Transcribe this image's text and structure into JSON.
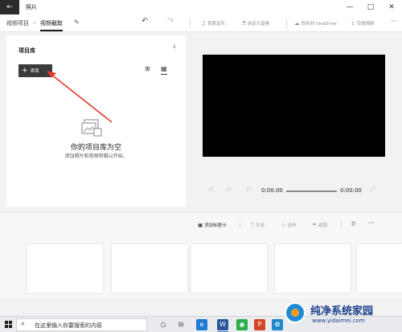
{
  "window": {
    "title": "照片",
    "back": "←",
    "minimize": "—",
    "maximize": "□",
    "close": "✕"
  },
  "toolbar": {
    "breadcrumb": [
      "视频项目",
      "视频截取"
    ],
    "edit_icon": "✎",
    "undo_icon": "↶",
    "redo_icon": "↷",
    "bg_music": "背景音乐",
    "custom_audio": "自定义音频",
    "sync": "同步到 OneDrive",
    "finish": "完成视频",
    "more": "···",
    "icons": {
      "music": "♫",
      "audio": "♬",
      "cloud": "☁",
      "export": "⇪"
    }
  },
  "library": {
    "title": "项目库",
    "collapse": "‹",
    "add_label": "添加",
    "add_icon": "+",
    "view_icons": [
      "⊞",
      "▦"
    ],
    "empty_title": "你的项目库为空",
    "empty_subtitle": "添加照片和视频剪辑以开始。"
  },
  "preview": {
    "rewind": "◁",
    "play": "▷",
    "forward": "▷",
    "time_current": "0:00.00",
    "time_total": "0:00.00",
    "fullscreen": "⤢"
  },
  "storyboard": {
    "add_title_card": "添加标题卡",
    "text": "文本",
    "motion": "动作",
    "filters": "滤镜",
    "more": "···",
    "icons": {
      "card": "▣",
      "trim": "⊡",
      "text": "T",
      "motion": "⊹",
      "filter": "☂",
      "delete": "🗑"
    }
  },
  "taskbar": {
    "search_placeholder": "在这里输入你要搜索的内容",
    "search_icon": "⌕",
    "apps": [
      {
        "glyph": "○",
        "color": "#333333"
      },
      {
        "glyph": "⊟",
        "color": "#333333"
      },
      {
        "glyph": "e",
        "color": "#1f7bd1"
      },
      {
        "glyph": "W",
        "color": "#2b579a"
      },
      {
        "glyph": "✉",
        "color": "#2f6fd6"
      },
      {
        "glyph": "◉",
        "color": "#2aae4a"
      },
      {
        "glyph": "P",
        "color": "#d24726"
      },
      {
        "glyph": "✿",
        "color": "#1e88c8"
      }
    ]
  },
  "watermark": {
    "title": "纯净系统家园",
    "url": "www.yidaimei.com"
  }
}
